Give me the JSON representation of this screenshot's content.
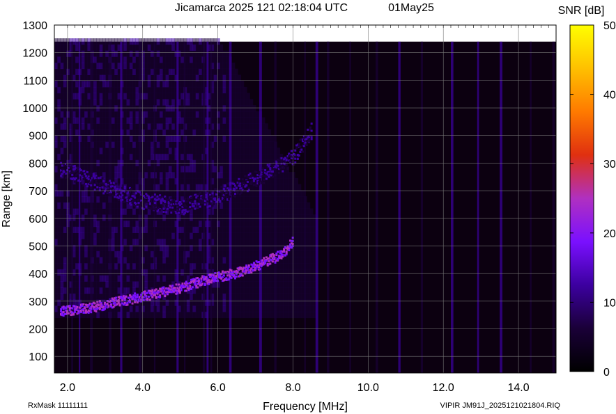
{
  "chart_data": {
    "type": "heatmap",
    "title": "Jicamarca 2025 121 02:18:04 UTC",
    "date": "01May25",
    "xlabel": "Frequency [MHz]",
    "ylabel": "Range [km]",
    "xlim": [
      1.65,
      15.0
    ],
    "ylim": [
      40,
      1300
    ],
    "x_ticks": [
      "2.0",
      "4.0",
      "6.0",
      "8.0",
      "10.0",
      "12.0",
      "14.0"
    ],
    "x_tick_values": [
      2,
      4,
      6,
      8,
      10,
      12,
      14
    ],
    "y_ticks": [
      "100",
      "200",
      "300",
      "400",
      "500",
      "600",
      "700",
      "800",
      "900",
      "1000",
      "1100",
      "1200",
      "1300"
    ],
    "y_tick_values": [
      100,
      200,
      300,
      400,
      500,
      600,
      700,
      800,
      900,
      1000,
      1100,
      1200,
      1300
    ],
    "data_range_max_km": 1240,
    "grid": true,
    "colorbar": {
      "label": "SNR [dB]",
      "min": 0,
      "max": 50,
      "ticks": [
        "0",
        "10",
        "20",
        "30",
        "40",
        "50"
      ],
      "tick_values": [
        0,
        10,
        20,
        30,
        40,
        50
      ],
      "colormap": [
        "#000000",
        "#1a0038",
        "#3c00a0",
        "#7a10ff",
        "#b030c0",
        "#e03010",
        "#ff7a00",
        "#ffc000",
        "#ffff00"
      ]
    },
    "traces": [
      {
        "name": "F-layer O trace",
        "points": [
          [
            1.8,
            260
          ],
          [
            2.5,
            272
          ],
          [
            3.0,
            285
          ],
          [
            3.5,
            300
          ],
          [
            4.0,
            315
          ],
          [
            4.5,
            330
          ],
          [
            5.0,
            345
          ],
          [
            5.5,
            368
          ],
          [
            5.8,
            380
          ],
          [
            6.5,
            400
          ],
          [
            7.0,
            425
          ],
          [
            7.5,
            455
          ],
          [
            7.8,
            480
          ],
          [
            8.0,
            520
          ]
        ],
        "snr_db": 28
      },
      {
        "name": "second-hop echo",
        "points": [
          [
            1.8,
            780
          ],
          [
            3.0,
            710
          ],
          [
            4.0,
            660
          ],
          [
            5.0,
            640
          ],
          [
            6.0,
            680
          ],
          [
            7.0,
            740
          ],
          [
            8.0,
            820
          ],
          [
            8.5,
            920
          ]
        ],
        "snr_db": 12
      }
    ]
  },
  "footer": {
    "left": "RxMask 11111111",
    "right": "VIPIR  JM91J_2025121021804.RIQ"
  }
}
